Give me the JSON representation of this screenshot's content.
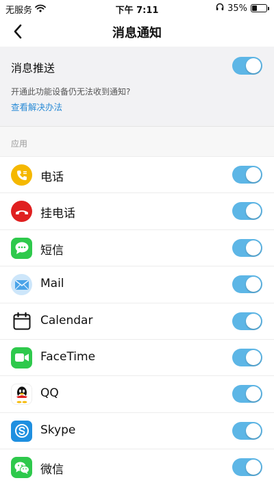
{
  "status_bar": {
    "carrier": "无服务",
    "time": "下午 7:11",
    "battery": "35%",
    "battery_level": 0.35
  },
  "nav": {
    "title": "消息通知"
  },
  "push": {
    "label": "消息推送",
    "enabled": true,
    "hint": "开通此功能设备仍无法收到通知?",
    "link": "查看解决办法"
  },
  "section": {
    "label": "应用"
  },
  "apps": [
    {
      "name": "电话",
      "icon": "phone-icon",
      "color": "#f5b800",
      "enabled": true
    },
    {
      "name": "挂电话",
      "icon": "hangup-icon",
      "color": "#e02020",
      "enabled": true
    },
    {
      "name": "短信",
      "icon": "message-icon",
      "color": "#2ec94c",
      "enabled": true
    },
    {
      "name": "Mail",
      "icon": "mail-icon",
      "color": "#4aa3e8",
      "enabled": true
    },
    {
      "name": "Calendar",
      "icon": "calendar-icon",
      "color": "#111111",
      "enabled": true
    },
    {
      "name": "FaceTime",
      "icon": "facetime-icon",
      "color": "#2ec94c",
      "enabled": true
    },
    {
      "name": "QQ",
      "icon": "qq-icon",
      "color": "#111111",
      "enabled": true
    },
    {
      "name": "Skype",
      "icon": "skype-icon",
      "color": "#1f8fe0",
      "enabled": true
    },
    {
      "name": "微信",
      "icon": "wechat-icon",
      "color": "#2ec94c",
      "enabled": true
    }
  ],
  "colors": {
    "toggle_on": "#5db6e6",
    "link": "#2a8bd6"
  }
}
